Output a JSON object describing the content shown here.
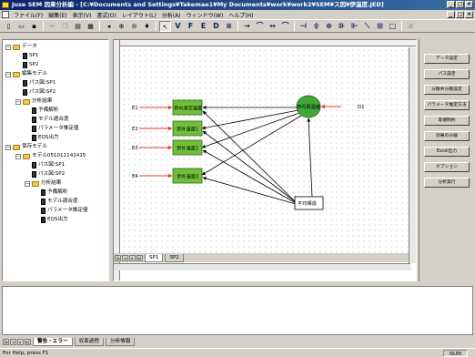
{
  "window": {
    "title": "Juse SEM 因果分析編 - [C:¥Documents and Settings¥Takemae1¥My Documents¥work¥work2¥SEM¥ス因¥伊温度.JED]"
  },
  "menu": [
    "ファイル(F)",
    "編集(E)",
    "表示(V)",
    "書式(O)",
    "レイアウト(L)",
    "分析(A)",
    "ウィンドウ(W)",
    "ヘルプ(H)"
  ],
  "toolbar": {
    "tools": [
      "V",
      "F",
      "E",
      "D",
      "≡"
    ]
  },
  "tree": {
    "data": "データ",
    "sp1": "SP1",
    "sp2": "SP2",
    "edit_model": "編集モデル",
    "path_sp1": "パス図:SP1",
    "path_sp2": "パス図:SP2",
    "results": "分析結果",
    "pre_analysis": "予備解析",
    "fit": "モデル適合度",
    "param_est": "パラメータ推定値",
    "eqs": "EQS出力",
    "saved_model": "保存モデル",
    "model_id": "モデル051011141415",
    "path_sp1b": "パス図:SP1",
    "path_sp2b": "パス図:SP2",
    "results2": "分析結果",
    "pre_analysis2": "予備解析",
    "fit2": "モデル適合度",
    "param_est2": "パラメータ推定値",
    "eqs2": "EQS出力"
  },
  "diagram": {
    "latent": "伊内興温度",
    "obs1": "伊内測定温度",
    "obs2": "伊外温度1",
    "obs3": "伊外温度2",
    "obs4": "伊外温度3",
    "err1": "E1",
    "err2": "E2",
    "err3": "E3",
    "err4": "E4",
    "disturbance": "D1",
    "mean_struct": "平均構造"
  },
  "sheets": [
    "SP1",
    "SP2"
  ],
  "commands": [
    "データ設定",
    "パス設定",
    "分散共分散設定",
    "パラメータ推定方法",
    "等値制約",
    "効果の分解",
    "Excel出力",
    "オプション",
    "分析実行"
  ],
  "output_tabs": [
    "警告・エラー",
    "収束過程",
    "分析情報"
  ],
  "status": {
    "help": "For Help, press F1",
    "num": "NUM"
  },
  "colors": {
    "observed_fill": "#6fbf3a",
    "latent_fill": "#3fa838",
    "arrow_red": "#e8392a",
    "titlebar": "#0a246a"
  }
}
